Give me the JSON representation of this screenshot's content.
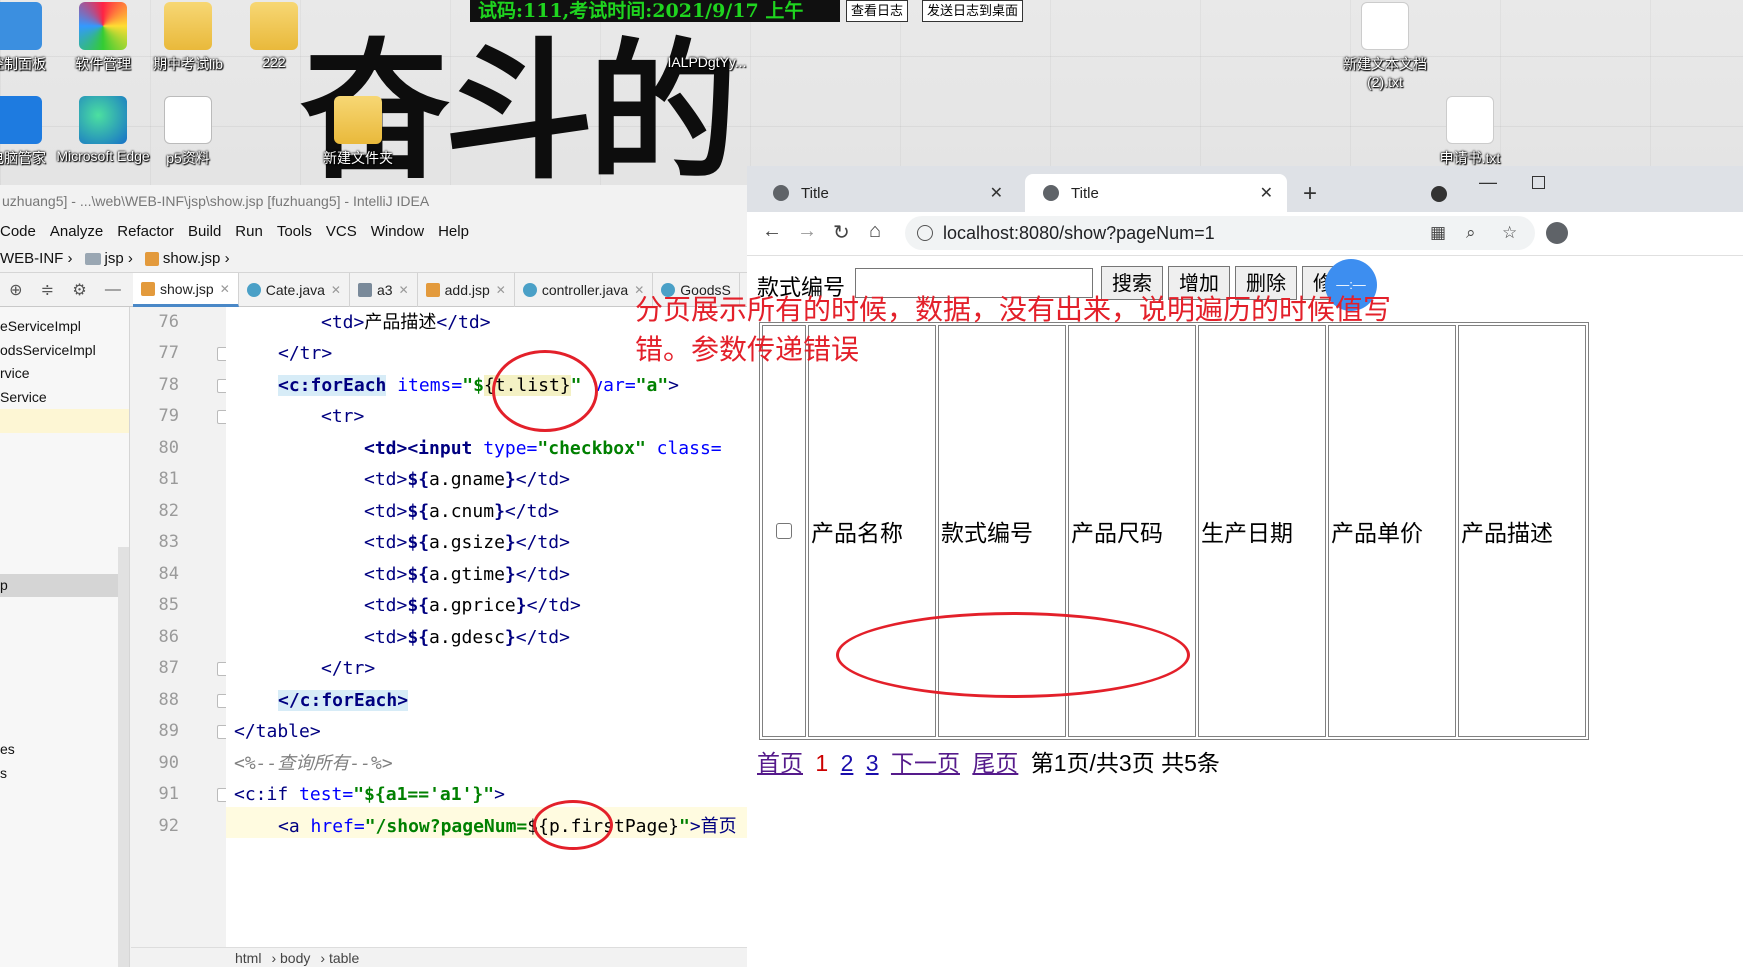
{
  "desktop": {
    "banner": "试码:111,考试时间:2021/9/17 上午",
    "banner_buttons": [
      "查看日志",
      "发送日志到桌面"
    ],
    "calligraphy": "奋斗的",
    "icons": [
      {
        "label": "控制面板",
        "icon": "control-panel-icon"
      },
      {
        "label": "软件管理",
        "icon": "software-manager-icon"
      },
      {
        "label": "期中考试lib",
        "icon": "folder-icon"
      },
      {
        "label": "222",
        "icon": "folder-icon"
      },
      {
        "label": "IALPDgtYy...",
        "icon": "file-icon"
      },
      {
        "label": "新建文本文档 (2).txt",
        "icon": "text-file-icon"
      },
      {
        "label": "电脑管家",
        "icon": "pc-manager-icon"
      },
      {
        "label": "Microsoft Edge",
        "icon": "edge-icon"
      },
      {
        "label": "p5资料",
        "icon": "word-doc-icon"
      },
      {
        "label": "新建文件夹",
        "icon": "folder-icon"
      },
      {
        "label": "申请书.txt",
        "icon": "text-file-icon"
      }
    ]
  },
  "ide": {
    "title": "uzhuang5] - ...\\web\\WEB-INF\\jsp\\show.jsp [fuzhuang5] - IntelliJ IDEA",
    "menu": [
      "Code",
      "Analyze",
      "Refactor",
      "Build",
      "Run",
      "Tools",
      "VCS",
      "Window",
      "Help"
    ],
    "breadcrumb": [
      "WEB-INF",
      "jsp",
      "show.jsp"
    ],
    "tabs": [
      {
        "label": "show.jsp",
        "type": "jsp",
        "active": true
      },
      {
        "label": "Cate.java",
        "type": "java"
      },
      {
        "label": "a3",
        "type": "js"
      },
      {
        "label": "add.jsp",
        "type": "jsp"
      },
      {
        "label": "controller.java",
        "type": "java"
      },
      {
        "label": "GoodsS",
        "type": "java"
      }
    ],
    "project_items": [
      "eServiceImpl",
      "odsServiceImpl",
      "rvice",
      "Service",
      "",
      "",
      "",
      "",
      "",
      "",
      "",
      "p",
      "",
      "",
      "",
      "",
      "",
      "",
      "es",
      "s"
    ],
    "line_numbers": [
      "76",
      "77",
      "78",
      "79",
      "80",
      "81",
      "82",
      "83",
      "84",
      "85",
      "86",
      "87",
      "88",
      "89",
      "90",
      "91",
      "92"
    ],
    "status_path": [
      "html",
      "body",
      "table"
    ],
    "code": {
      "l76a": "<td>",
      "l76b": "产品描述",
      "l76c": "</td>",
      "l77": "</tr>",
      "l78a": "<c:forEach",
      "l78b": " items=",
      "l78c": "\"$",
      "l78d": "{t.list}",
      "l78e": "\"",
      "l78f": " var=",
      "l78g": "\"a\"",
      "l78h": ">",
      "l79": "<tr>",
      "l80a": "<td><input",
      "l80b": " type=",
      "l80c": "\"checkbox\"",
      "l80d": " class=",
      "l81a": "<td>",
      "l81b": "${",
      "l81c": "a.gname",
      "l81d": "}",
      "l81e": "</td>",
      "l82c": "a.cnum",
      "l83c": "a.gsize",
      "l84c": "a.gtime",
      "l85c": "a.gprice",
      "l86c": "a.gdesc",
      "l87": "</tr>",
      "l88": "</c:forEach>",
      "l89": "</table>",
      "l90": "<%--查询所有--%>",
      "l91a": "<c:if",
      "l91b": " test=",
      "l91c": "\"${a1=='a1'}\"",
      "l91d": ">",
      "l92a": "<a",
      "l92b": " href=",
      "l92c": "\"/show?pageNum=",
      "l92d": "${p.firstPage}",
      "l92e": "\"",
      "l92f": ">首页"
    }
  },
  "browser": {
    "tabs": [
      {
        "title": "Title",
        "active": false
      },
      {
        "title": "Title",
        "active": true
      }
    ],
    "new_tab": "+",
    "url": "localhost:8080/show?pageNum=1",
    "content": {
      "search_label": "款式编号",
      "search_value": "",
      "buttons": [
        "搜索",
        "增加",
        "删除",
        "修改"
      ],
      "table_headers": [
        "产品名称",
        "款式编号",
        "产品尺码",
        "生产日期",
        "产品单价",
        "产品描述"
      ],
      "pager": {
        "first": "首页",
        "pages": [
          "1",
          "2",
          "3"
        ],
        "next": "下一页",
        "last": "尾页",
        "summary": "第1页/共3页 共5条"
      }
    }
  },
  "annotation": {
    "text": "分页展示所有的时候，数据，没有出来，说明遍历的时候值写错。参数传递错误",
    "color": "#e3202a"
  }
}
